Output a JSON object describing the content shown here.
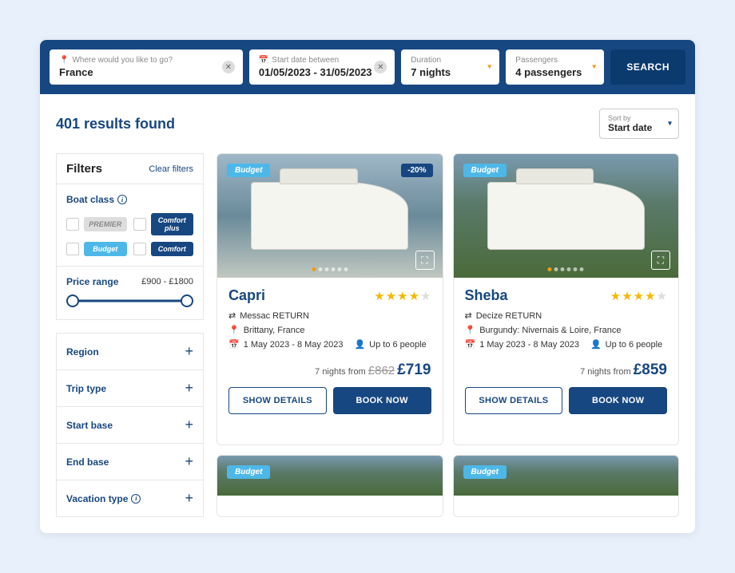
{
  "search": {
    "destination": {
      "label": "Where would you like to go?",
      "value": "France"
    },
    "dates": {
      "label": "Start date between",
      "value": "01/05/2023 - 31/05/2023"
    },
    "duration": {
      "label": "Duration",
      "value": "7 nights"
    },
    "passengers": {
      "label": "Passengers",
      "value": "4 passengers"
    },
    "button": "SEARCH"
  },
  "results": {
    "count_text": "401 results found",
    "sort": {
      "label": "Sort by",
      "value": "Start date"
    }
  },
  "filters": {
    "title": "Filters",
    "clear": "Clear filters",
    "boat_class": {
      "heading": "Boat class",
      "options": [
        "PREMIER",
        "Comfort plus",
        "Budget",
        "Comfort"
      ]
    },
    "price_range": {
      "heading": "Price range",
      "value": "£900 - £1800"
    },
    "rows": [
      {
        "label": "Region",
        "info": false
      },
      {
        "label": "Trip type",
        "info": false
      },
      {
        "label": "Start base",
        "info": false
      },
      {
        "label": "End base",
        "info": false
      },
      {
        "label": "Vacation type",
        "info": true
      }
    ]
  },
  "cards": [
    {
      "badge": "Budget",
      "discount": "-20%",
      "title": "Capri",
      "stars": 4,
      "route": "Messac RETURN",
      "location": "Brittany, France",
      "dates": "1 May 2023 - 8 May 2023",
      "capacity": "Up to 6 people",
      "nights_from": "7 nights from",
      "price_old": "£862",
      "price_new": "£719",
      "details_btn": "SHOW DETAILS",
      "book_btn": "BOOK NOW"
    },
    {
      "badge": "Budget",
      "discount": "",
      "title": "Sheba",
      "stars": 4,
      "route": "Decize RETURN",
      "location": "Burgundy: Nivernais & Loire, France",
      "dates": "1 May 2023 - 8 May 2023",
      "capacity": "Up to 6 people",
      "nights_from": "7 nights from",
      "price_old": "",
      "price_new": "£859",
      "details_btn": "SHOW DETAILS",
      "book_btn": "BOOK NOW"
    }
  ],
  "partial_cards": [
    {
      "badge": "Budget"
    },
    {
      "badge": "Budget"
    }
  ]
}
